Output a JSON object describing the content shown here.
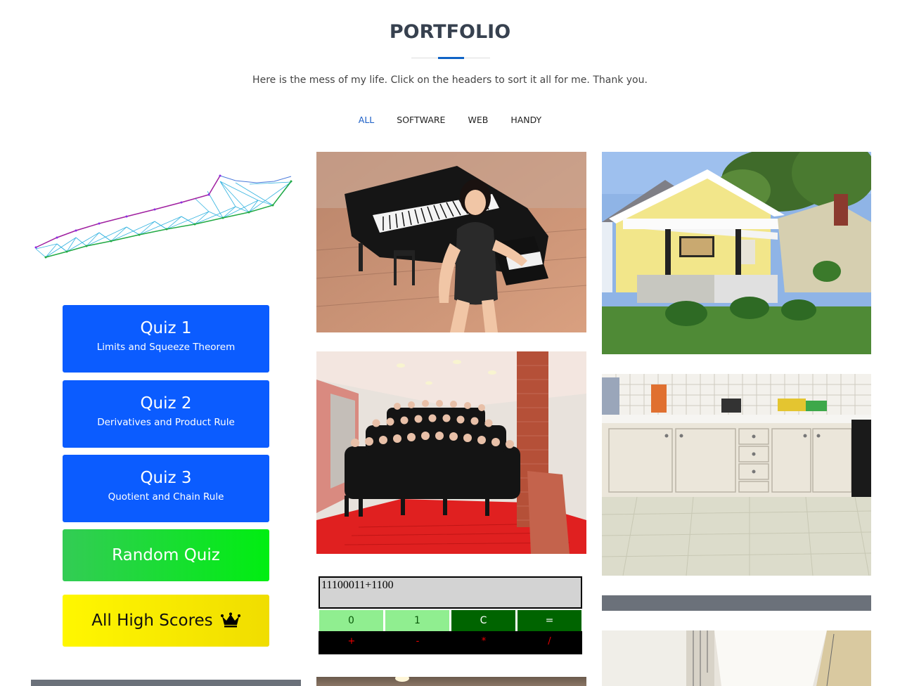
{
  "header": {
    "title": "PORTFOLIO",
    "subtitle": "Here is the mess of my life. Click on the headers to sort it all for me. Thank you."
  },
  "filters": [
    "ALL",
    "SOFTWARE",
    "WEB",
    "HANDY"
  ],
  "active_filter": "ALL",
  "quizzes": [
    {
      "title": "Quiz 1",
      "subtitle": "Limits and Squeeze Theorem"
    },
    {
      "title": "Quiz 2",
      "subtitle": "Derivatives and Product Rule"
    },
    {
      "title": "Quiz 3",
      "subtitle": "Quotient and Chain Rule"
    }
  ],
  "random_quiz_label": "Random Quiz",
  "high_scores_label": "All High Scores",
  "calculator": {
    "display": "11100011+1100",
    "keys": [
      "0",
      "1",
      "C",
      "="
    ],
    "operators": [
      "+",
      "-",
      "*",
      "/"
    ]
  },
  "colors": {
    "accent": "#0f63c6",
    "quiz_blue": "#0b5cff",
    "random_green": "#22dd22",
    "high_scores_yellow": "#f7e800",
    "title": "#37414f"
  }
}
